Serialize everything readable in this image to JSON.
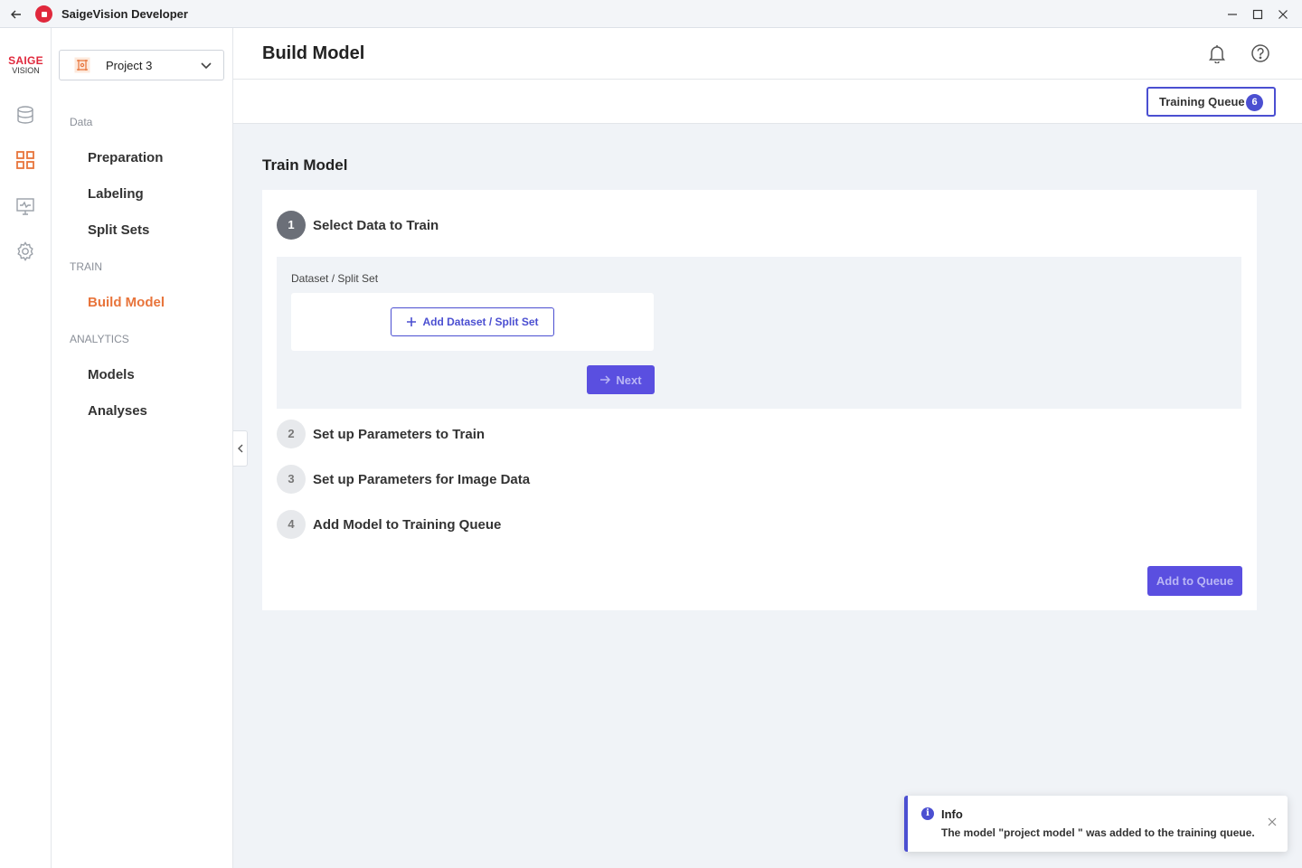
{
  "window": {
    "title": "SaigeVision Developer",
    "back_icon": "arrow-left-icon",
    "app_icon": "saige-app-icon",
    "controls": [
      "minimize-icon",
      "maximize-icon",
      "close-icon"
    ]
  },
  "brand": {
    "line1": "SAIGE",
    "line2": "VISION",
    "color": "#e0283c"
  },
  "rail": {
    "icons": [
      "database-icon",
      "grid-icon",
      "monitor-chart-icon",
      "gear-icon"
    ],
    "active_icon": "grid-icon"
  },
  "sidebar": {
    "project_selector": {
      "value": "Project 3",
      "icon": "project-frame-icon"
    },
    "sections": [
      {
        "heading": "Data",
        "items": [
          "Preparation",
          "Labeling",
          "Split Sets"
        ]
      },
      {
        "heading": "TRAIN",
        "items": [
          "Build Model"
        ]
      },
      {
        "heading": "ANALYTICS",
        "items": [
          "Models",
          "Analyses"
        ]
      }
    ],
    "active_item": "Build Model",
    "accent_color": "#e8743b"
  },
  "header": {
    "title": "Build Model",
    "icons": [
      "bell-icon",
      "help-circle-icon"
    ]
  },
  "subbar": {
    "training_queue_label": "Training Queue",
    "training_queue_count": "6"
  },
  "main": {
    "section_title": "Train Model",
    "steps": [
      {
        "number": "1",
        "label": "Select Data to Train",
        "state": "active"
      },
      {
        "number": "2",
        "label": "Set up Parameters to Train",
        "state": "inactive"
      },
      {
        "number": "3",
        "label": "Set up Parameters for Image Data",
        "state": "inactive"
      },
      {
        "number": "4",
        "label": "Add Model to Training Queue",
        "state": "inactive"
      }
    ],
    "step1": {
      "field_label": "Dataset / Split Set",
      "add_button_label": "Add Dataset / Split Set",
      "next_button_label": "Next"
    },
    "add_to_queue_label": "Add to Queue",
    "primary_color": "#4b4fd1"
  },
  "toast": {
    "title": "Info",
    "message": "The model \"project model \" was added to the training queue."
  }
}
